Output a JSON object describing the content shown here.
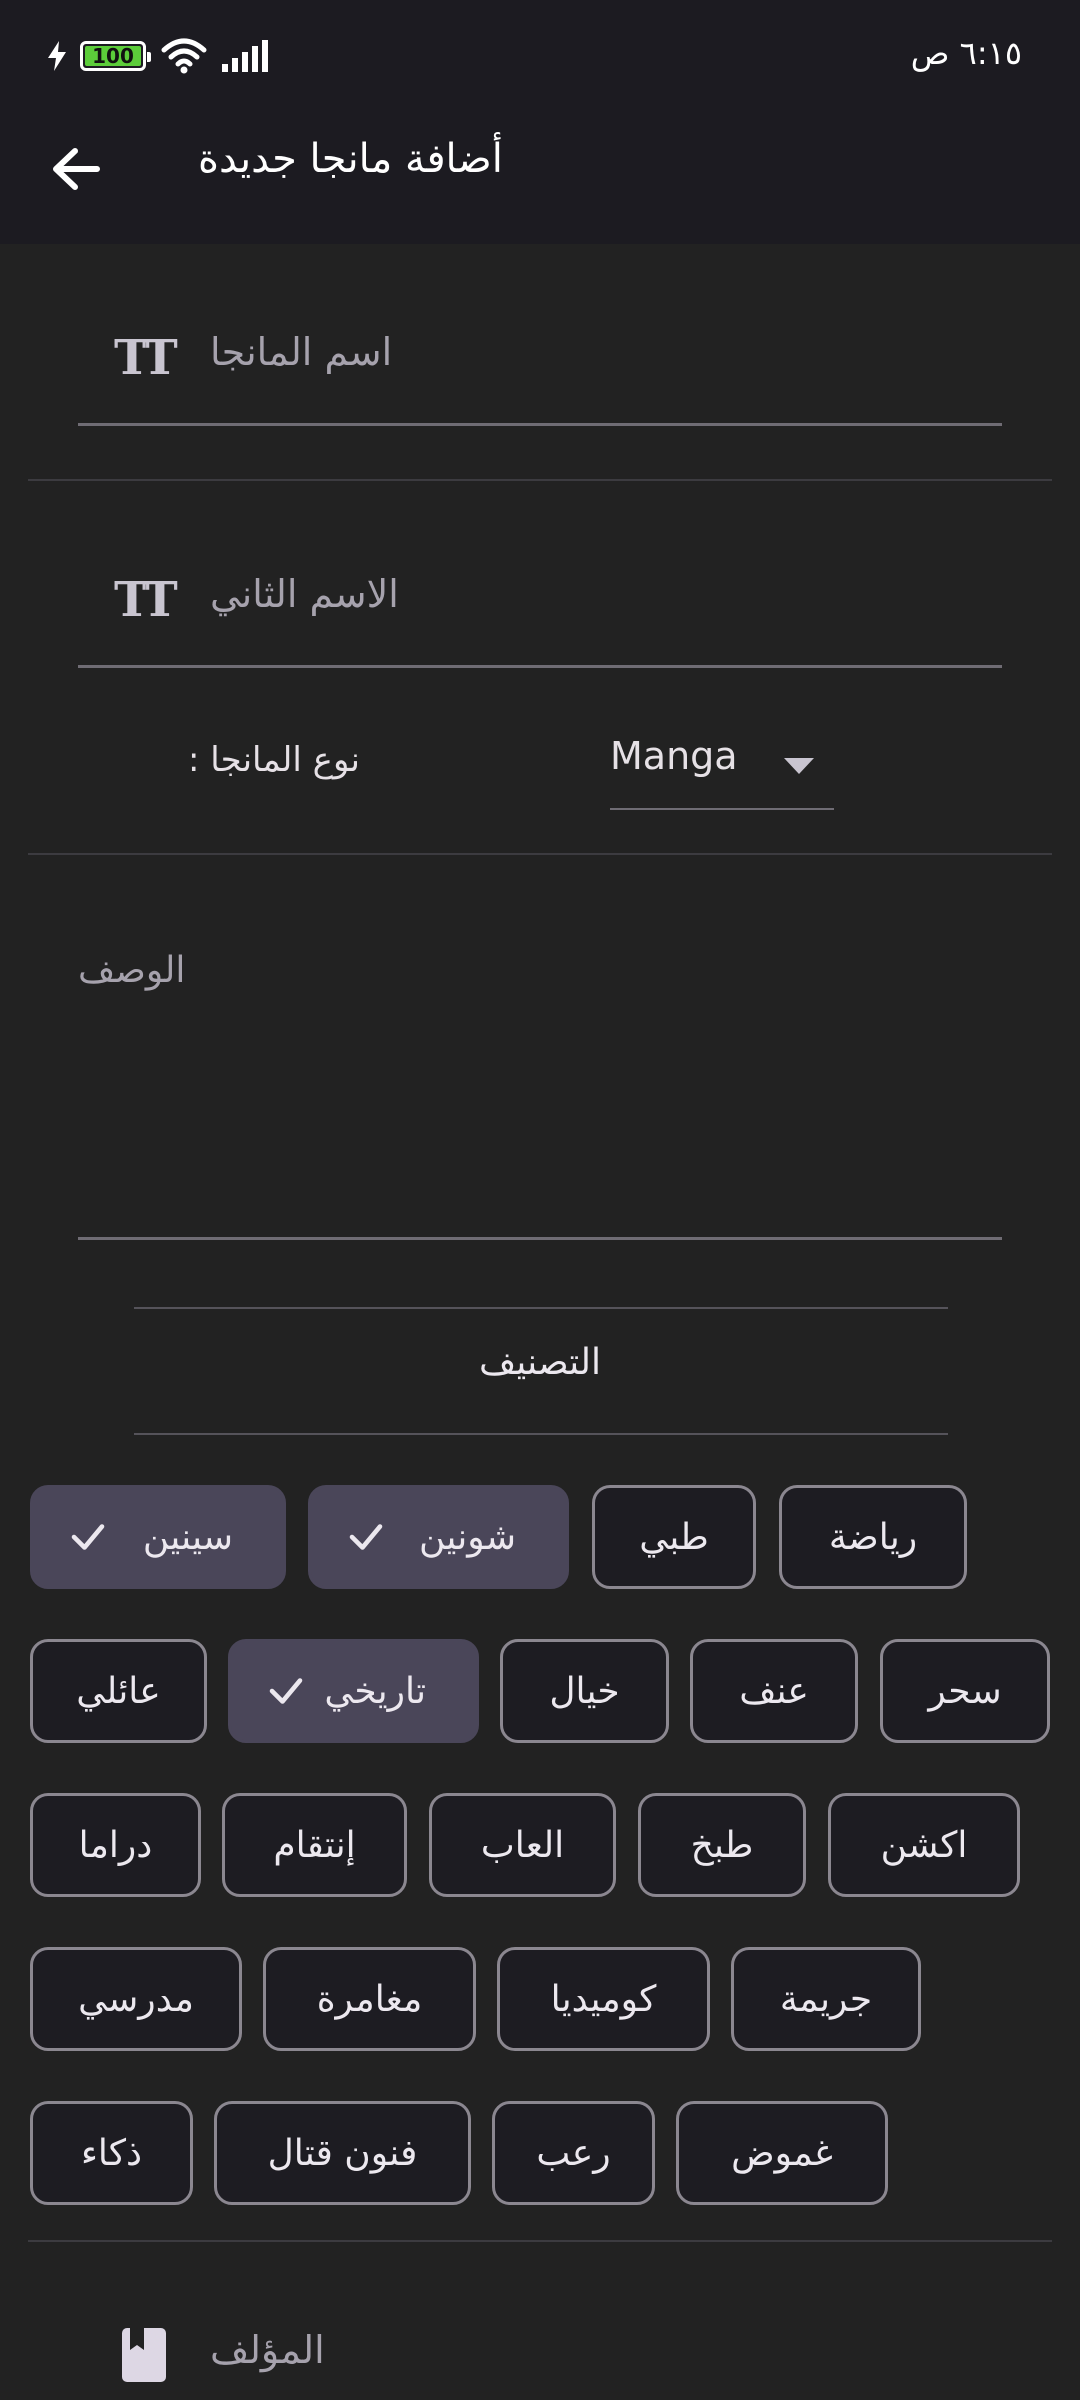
{
  "status_bar": {
    "time": "٦:١٥ ص",
    "battery": "100"
  },
  "app_bar": {
    "title": "أضافة مانجا جديدة"
  },
  "form": {
    "manga_name_placeholder": "اسم المانجا",
    "second_name_placeholder": "الاسم الثاني",
    "type_label": ": نوع المانجا",
    "type_value": "Manga",
    "description_placeholder": "الوصف",
    "author_placeholder": "المؤلف"
  },
  "genres": {
    "title": "التصنيف",
    "rows": [
      [
        {
          "label": "رياضة",
          "selected": false
        },
        {
          "label": "طبي",
          "selected": false
        },
        {
          "label": "شونين",
          "selected": true
        },
        {
          "label": "سينين",
          "selected": true
        }
      ],
      [
        {
          "label": "سحر",
          "selected": false
        },
        {
          "label": "عنف",
          "selected": false
        },
        {
          "label": "خيال",
          "selected": false
        },
        {
          "label": "تاريخي",
          "selected": true
        },
        {
          "label": "عائلي",
          "selected": false
        }
      ],
      [
        {
          "label": "اكشن",
          "selected": false
        },
        {
          "label": "طبخ",
          "selected": false
        },
        {
          "label": "العاب",
          "selected": false
        },
        {
          "label": "إنتقام",
          "selected": false
        },
        {
          "label": "دراما",
          "selected": false
        }
      ],
      [
        {
          "label": "جريمة",
          "selected": false
        },
        {
          "label": "كوميديا",
          "selected": false
        },
        {
          "label": "مغامرة",
          "selected": false
        },
        {
          "label": "مدرسي",
          "selected": false
        }
      ],
      [
        {
          "label": "غموض",
          "selected": false
        },
        {
          "label": "رعب",
          "selected": false
        },
        {
          "label": "فنون قتال",
          "selected": false
        },
        {
          "label": "ذكاء",
          "selected": false
        }
      ]
    ]
  },
  "colors": {
    "background": "#222222",
    "app_bar": "#1c1b21",
    "chip_selected": "#4a4659",
    "chip_border": "#8b8790",
    "battery": "#5ccd3a"
  },
  "icons": {
    "back": "arrow-left-icon",
    "text_field": "text-fields-icon",
    "dropdown": "caret-down-icon",
    "check": "check-icon",
    "author": "book-icon"
  }
}
